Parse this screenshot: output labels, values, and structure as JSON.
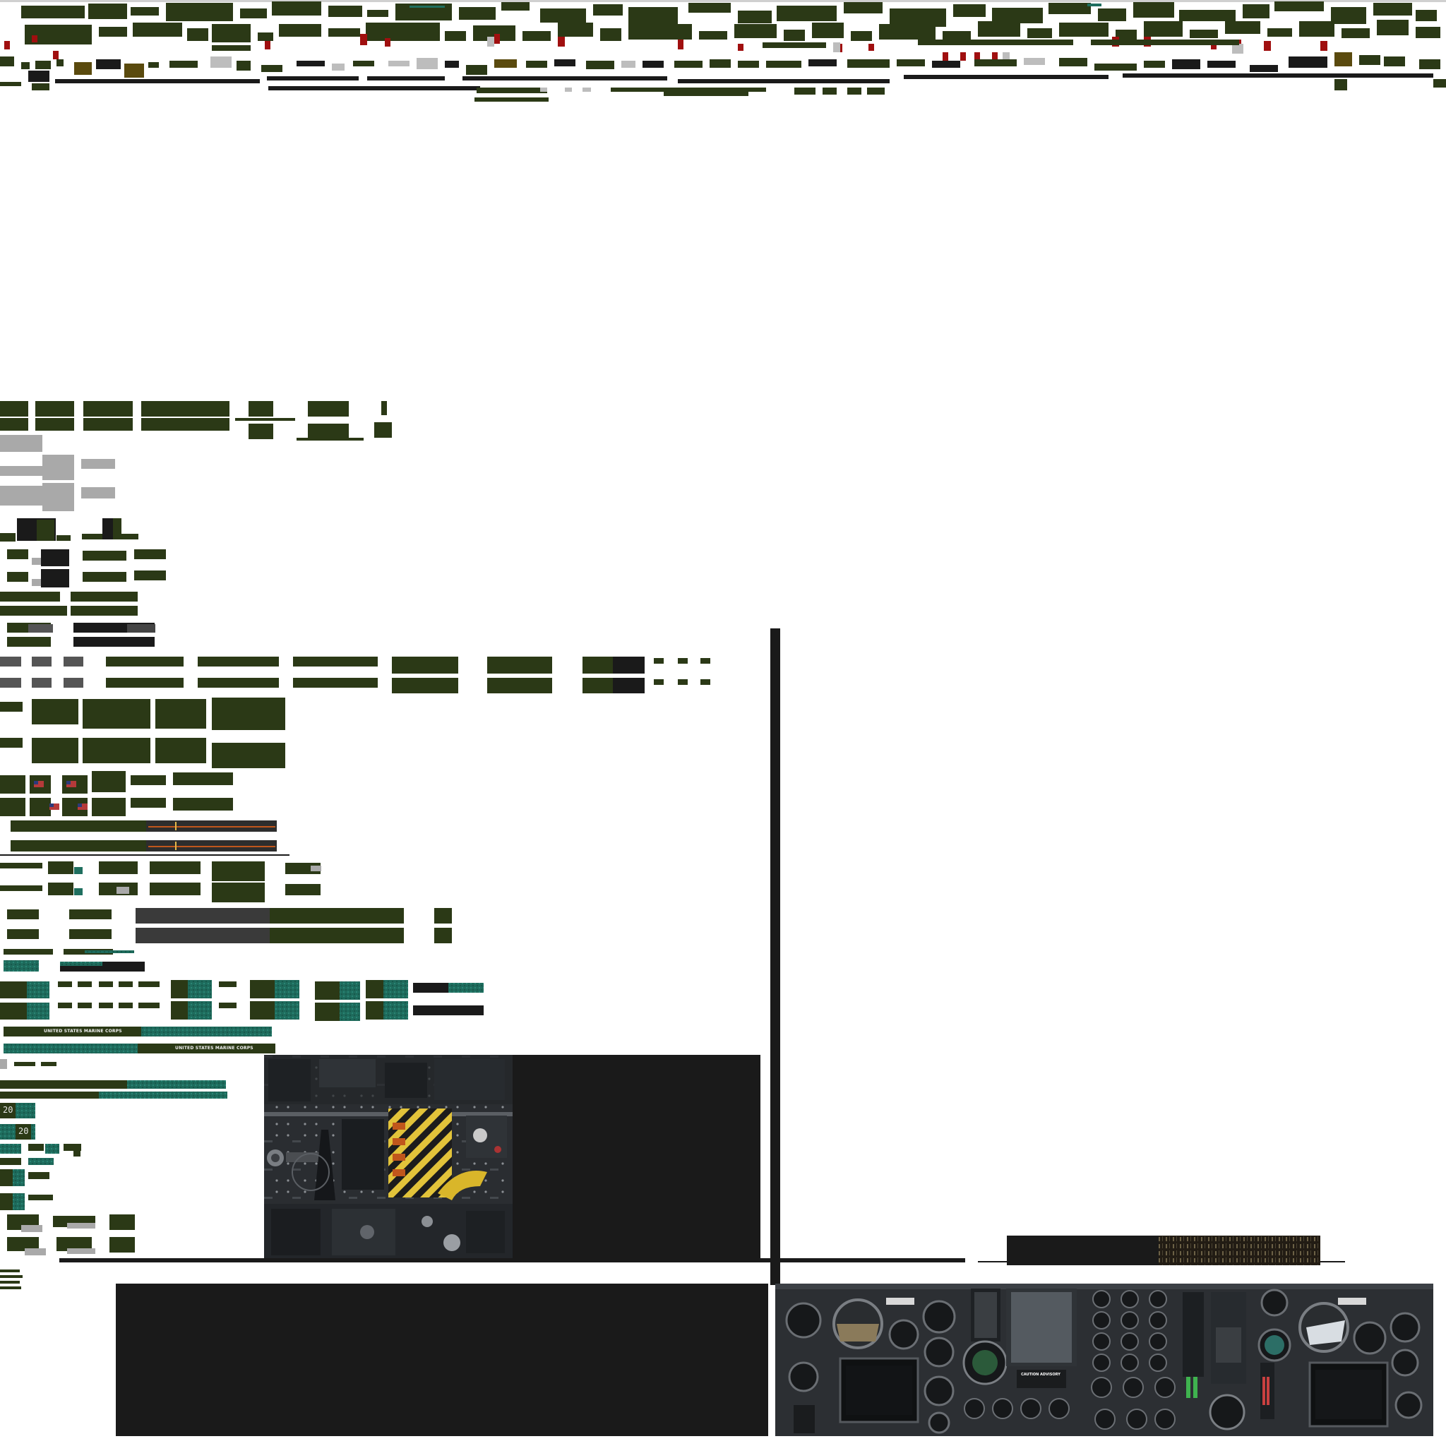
{
  "title": "",
  "labels": {
    "marine_corps_top": "UNITED STATES MARINE CORPS",
    "marine_corps_bottom": "UNITED STATES MARINE CORPS",
    "number_a": "20",
    "number_b": "20",
    "caution_advisory": "CAUTION ADVISORY"
  },
  "colors": {
    "background": "#ffffff",
    "olive": "#2b3916",
    "dark_panel": "#1a1a1a",
    "teal": "#1f6f5f",
    "red_swatch": "#a00f0f",
    "grey": "#a9a9a9",
    "hazard_yellow": "#d9b62a",
    "rust": "#c0561c"
  },
  "regions": [
    {
      "name": "top-texture-strip"
    },
    {
      "name": "left-texture-column"
    },
    {
      "name": "overhead-console-photo"
    },
    {
      "name": "instrument-panel-photo"
    },
    {
      "name": "dark-fill-block"
    }
  ]
}
